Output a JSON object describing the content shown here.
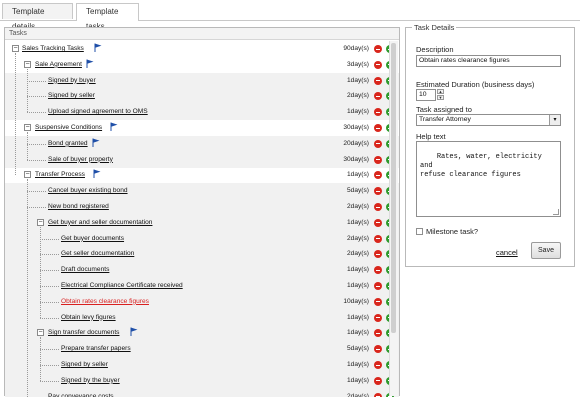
{
  "tabs": [
    {
      "label": "Template details",
      "active": false
    },
    {
      "label": "Template tasks",
      "active": true
    }
  ],
  "tasks_panel": {
    "title": "Tasks",
    "rows": [
      {
        "label": "Sales Tracking Tasks",
        "duration": "90day(s)",
        "level": 0,
        "expander": "−",
        "flag": true,
        "red": false
      },
      {
        "label": "Sale Agreement",
        "duration": "3day(s)",
        "level": 1,
        "expander": "−",
        "flag": true,
        "red": false
      },
      {
        "label": "Signed by buyer",
        "duration": "1day(s)",
        "level": 2,
        "expander": "",
        "flag": false,
        "red": false
      },
      {
        "label": "Signed by seller",
        "duration": "2day(s)",
        "level": 2,
        "expander": "",
        "flag": false,
        "red": false
      },
      {
        "label": "Upload signed agreement to OMS",
        "duration": "1day(s)",
        "level": 2,
        "expander": "",
        "flag": false,
        "red": false
      },
      {
        "label": "Suspensive Conditions",
        "duration": "30day(s)",
        "level": 1,
        "expander": "−",
        "flag": true,
        "red": false
      },
      {
        "label": "Bond granted",
        "duration": "20day(s)",
        "level": 2,
        "expander": "",
        "flag": true,
        "red": false
      },
      {
        "label": "Sale of buyer property",
        "duration": "30day(s)",
        "level": 2,
        "expander": "",
        "flag": false,
        "red": false
      },
      {
        "label": "Transfer Process",
        "duration": "1day(s)",
        "level": 1,
        "expander": "−",
        "flag": true,
        "red": false
      },
      {
        "label": "Cancel buyer existing bond",
        "duration": "5day(s)",
        "level": 2,
        "expander": "",
        "flag": false,
        "red": false
      },
      {
        "label": "New bond registered",
        "duration": "2day(s)",
        "level": 2,
        "expander": "",
        "flag": false,
        "red": false
      },
      {
        "label": "Get buyer and seller documentation",
        "duration": "1day(s)",
        "level": 2,
        "expander": "−",
        "flag": false,
        "red": false
      },
      {
        "label": "Get buyer documents",
        "duration": "2day(s)",
        "level": 3,
        "expander": "",
        "flag": false,
        "red": false
      },
      {
        "label": "Get seller documentation",
        "duration": "2day(s)",
        "level": 3,
        "expander": "",
        "flag": false,
        "red": false
      },
      {
        "label": "Draft documents",
        "duration": "1day(s)",
        "level": 3,
        "expander": "",
        "flag": false,
        "red": false
      },
      {
        "label": "Electrical Compliance Certificate received",
        "duration": "1day(s)",
        "level": 3,
        "expander": "",
        "flag": false,
        "red": false
      },
      {
        "label": "Obtain rates clearance figures",
        "duration": "10day(s)",
        "level": 3,
        "expander": "",
        "flag": false,
        "red": true
      },
      {
        "label": "Obtain levy figures",
        "duration": "1day(s)",
        "level": 3,
        "expander": "",
        "flag": false,
        "red": false
      },
      {
        "label": "Sign transfer documents",
        "duration": "1day(s)",
        "level": 2,
        "expander": "−",
        "flag": true,
        "red": false
      },
      {
        "label": "Prepare transfer papers",
        "duration": "5day(s)",
        "level": 3,
        "expander": "",
        "flag": false,
        "red": false
      },
      {
        "label": "Signed by seller",
        "duration": "1day(s)",
        "level": 3,
        "expander": "",
        "flag": false,
        "red": false
      },
      {
        "label": "Signed by the buyer",
        "duration": "1day(s)",
        "level": 3,
        "expander": "",
        "flag": false,
        "red": false
      },
      {
        "label": "Pay conveyance costs",
        "duration": "2day(s)",
        "level": 2,
        "expander": "",
        "flag": false,
        "red": false
      }
    ]
  },
  "details": {
    "title": "Task Details",
    "description_label": "Description",
    "description_value": "Obtain rates clearance figures",
    "duration_label": "Estimated Duration (business days)",
    "duration_value": "10",
    "assigned_label": "Task assigned to",
    "assigned_value": "Transfer Attorney",
    "help_label": "Help text",
    "help_value": "Rates, water, electricity and\nrefuse clearance figures",
    "milestone_label": "Milestone task?",
    "cancel_label": "cancel",
    "save_label": "Save"
  },
  "colors": {
    "remove": "#d9261c",
    "add": "#2f9a2c",
    "flag": "#1f4fa8",
    "selected_task": "#d92020"
  }
}
